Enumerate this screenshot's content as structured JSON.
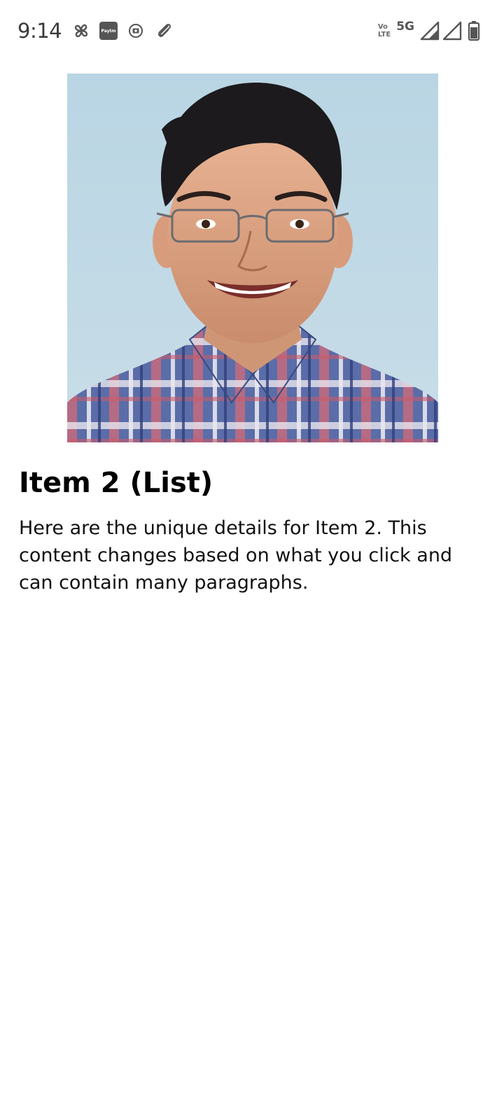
{
  "status_bar": {
    "time": "9:14",
    "paytm_label": "Paytm",
    "volte_top": "Vo",
    "volte_bottom": "LTE",
    "network": "5G",
    "icons": [
      "pinwheel-icon",
      "paytm-icon",
      "record-icon",
      "paperclip-icon",
      "volte-icon",
      "signal-icon",
      "signal-icon",
      "battery-icon"
    ]
  },
  "detail": {
    "image_icon": "portrait-photo",
    "title": "Item 2 (List)",
    "body": "Here are the unique details for Item 2. This content changes based on what you click and can contain many paragraphs."
  },
  "colors": {
    "background": "#ffffff",
    "photo_background": "#bcd5e3",
    "status_icon": "#555555"
  }
}
